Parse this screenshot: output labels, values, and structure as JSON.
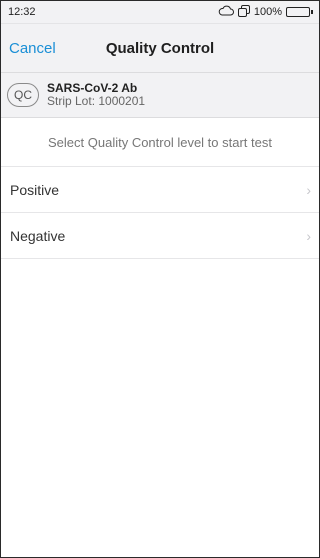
{
  "status_bar": {
    "time": "12:32",
    "cloud_icon": "☁",
    "sync_icon": "⧉",
    "battery_text": "100%"
  },
  "nav": {
    "cancel_label": "Cancel",
    "title": "Quality Control"
  },
  "test_info": {
    "badge": "QC",
    "name": "SARS-CoV-2 Ab",
    "strip_lot": "Strip Lot: 1000201"
  },
  "instruction": "Select Quality Control level to start test",
  "levels": [
    {
      "label": "Positive",
      "chevron": "›"
    },
    {
      "label": "Negative",
      "chevron": "›"
    }
  ],
  "colors": {
    "accent": "#1a8fd6",
    "header_bg": "#f2f2f4"
  }
}
